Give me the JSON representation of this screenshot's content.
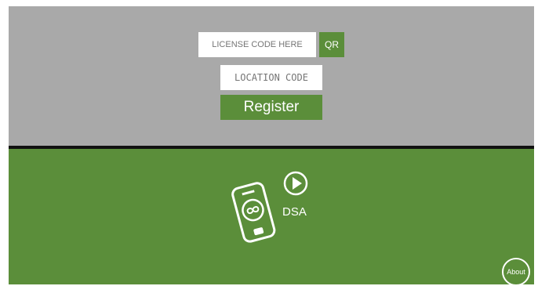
{
  "register_form": {
    "license_placeholder": "LICENSE CODE HERE",
    "qr_label": "QR",
    "location_placeholder": "LOCATION CODE",
    "register_label": "Register"
  },
  "app": {
    "logo_icon": "phone-infinity-play-icon",
    "logo_label": "DSA",
    "about_label": "About"
  },
  "colors": {
    "accent_green": "#5b8e3a",
    "top_background": "#a9a9a9",
    "divider": "#111111"
  }
}
